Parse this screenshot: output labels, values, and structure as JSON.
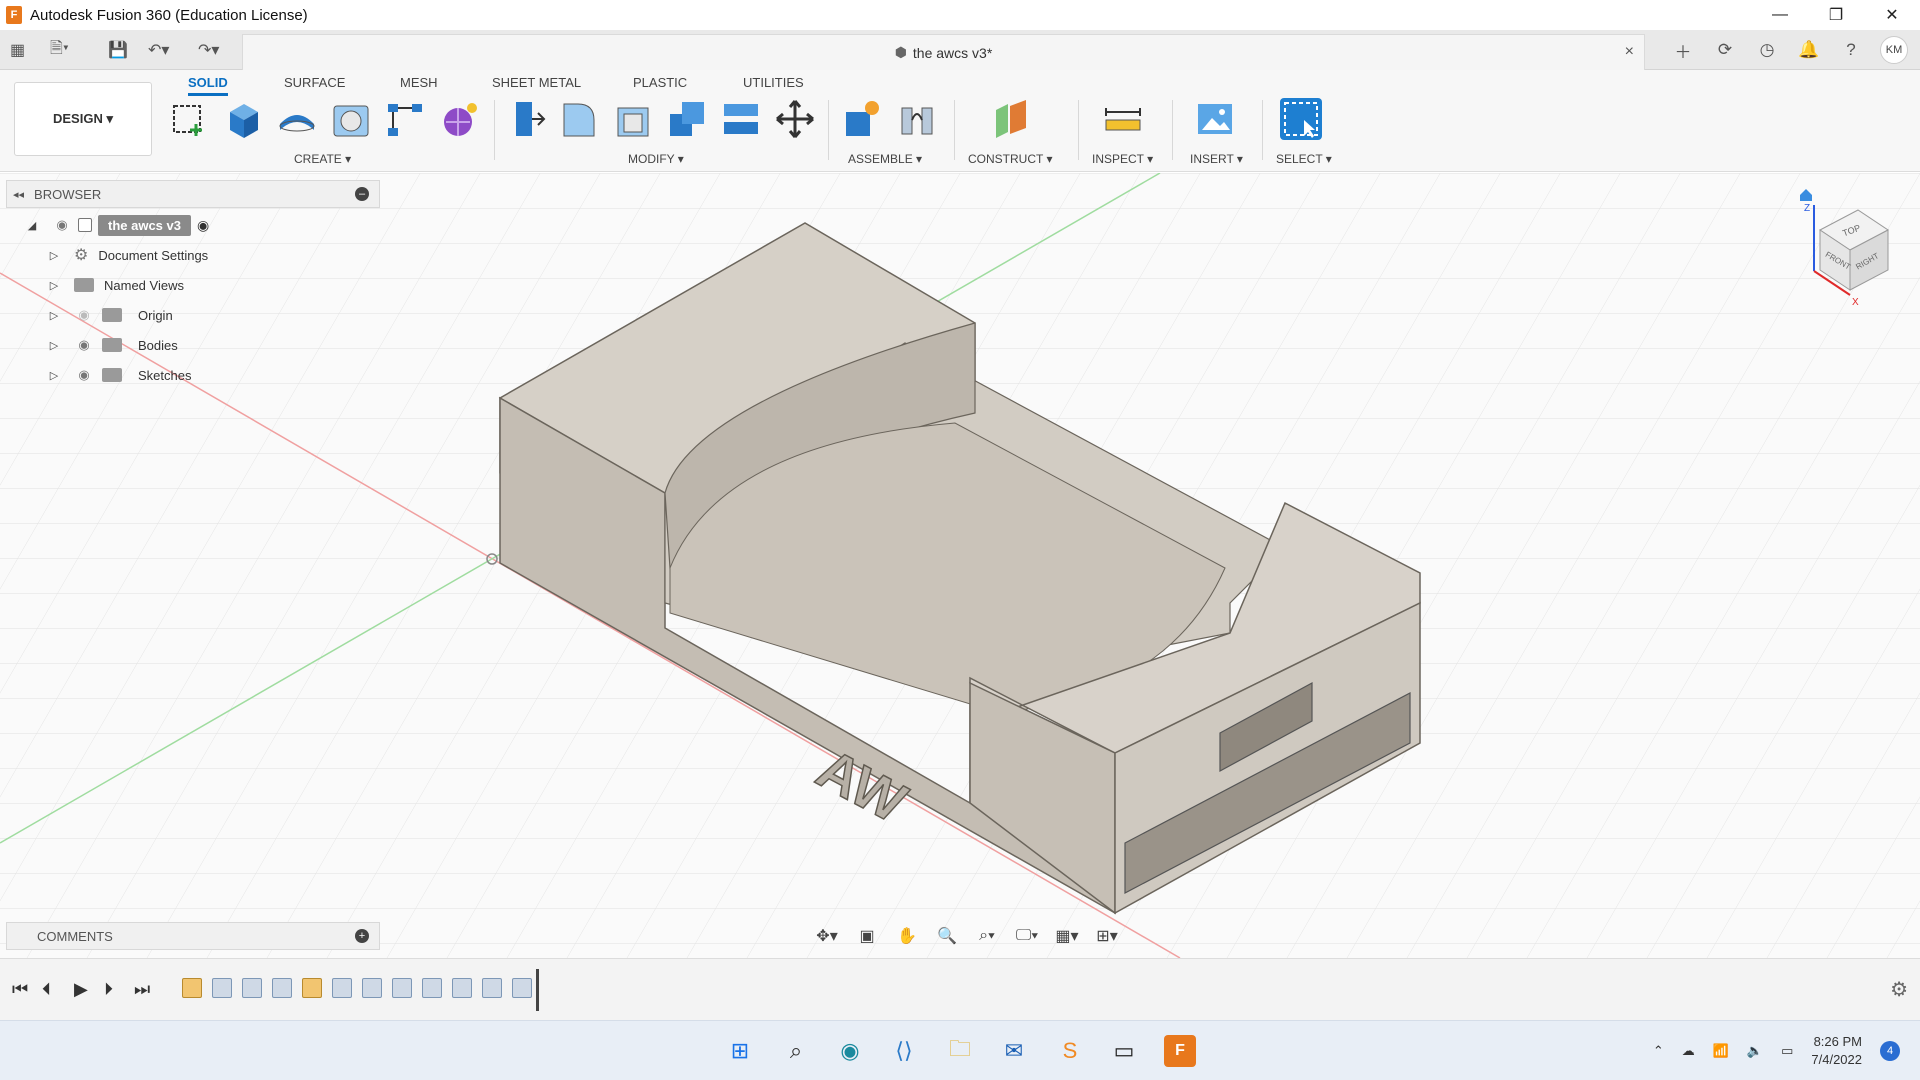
{
  "window": {
    "title": "Autodesk Fusion 360 (Education License)",
    "logo_text": "F",
    "minimize": "—",
    "restore": "❐",
    "close": "✕"
  },
  "tabbar": {
    "document_name": "the awcs v3*",
    "close": "×",
    "user_initials": "KM"
  },
  "toolbar": {
    "design_label": "DESIGN ▾",
    "workspace_tabs": [
      "SOLID",
      "SURFACE",
      "MESH",
      "SHEET METAL",
      "PLASTIC",
      "UTILITIES"
    ],
    "active_tab": "SOLID",
    "groups": [
      "CREATE ▾",
      "MODIFY ▾",
      "ASSEMBLE ▾",
      "CONSTRUCT ▾",
      "INSPECT ▾",
      "INSERT ▾",
      "SELECT ▾"
    ]
  },
  "browser": {
    "header": "BROWSER",
    "root": "the awcs v3",
    "items": [
      "Document Settings",
      "Named Views",
      "Origin",
      "Bodies",
      "Sketches"
    ]
  },
  "model": {
    "emboss_text": "AW"
  },
  "viewcube": {
    "top": "TOP",
    "front": "FRONT",
    "right": "RIGHT",
    "axis_z": "Z",
    "axis_x": "X"
  },
  "comments": {
    "label": "COMMENTS"
  },
  "taskbar": {
    "time": "8:26 PM",
    "date": "7/4/2022",
    "notifications": "4"
  },
  "colors": {
    "accent": "#0a6fc2",
    "model_top": "#d8d2ca",
    "model_side": "#bfb8ae",
    "fusion_orange": "#e8781c"
  }
}
